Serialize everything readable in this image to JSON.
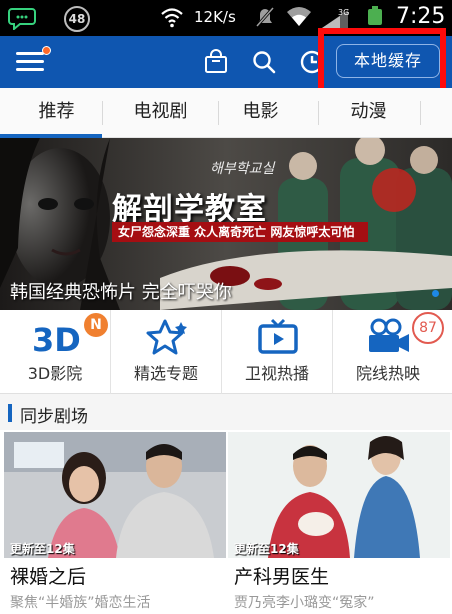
{
  "status_bar": {
    "notification_count": "48",
    "net_speed": "12K/s",
    "network_type": "3G",
    "time": "7:25"
  },
  "app_bar": {
    "menu_icon": "hamburger-menu-icon",
    "shop_icon": "shopping-bag-icon",
    "search_icon": "search-icon",
    "history_icon": "clock-icon",
    "local_cache_label": "本地缓存",
    "accent_color": "#0f56b0",
    "highlight_color": "#ff0b0b"
  },
  "tabs": [
    {
      "label": "推荐",
      "active": true
    },
    {
      "label": "电视剧",
      "active": false
    },
    {
      "label": "电影",
      "active": false
    },
    {
      "label": "动漫",
      "active": false
    }
  ],
  "banner": {
    "title": "解剖学教室",
    "korean_title": "해부학교실",
    "subtitle": "女尸怨念深重 众人离奇死亡 网友惊呼太可怕",
    "caption": "韩国经典恐怖片 完全吓哭你"
  },
  "categories": [
    {
      "label": "3D影院",
      "icon": "3d-icon",
      "badge": "N"
    },
    {
      "label": "精选专题",
      "icon": "star-icon"
    },
    {
      "label": "卫视热播",
      "icon": "tv-icon"
    },
    {
      "label": "院线热映",
      "icon": "movie-camera-icon"
    }
  ],
  "floating_badge": "87",
  "section": {
    "title": "同步剧场"
  },
  "cards": [
    {
      "update": "更新至12集",
      "title": "裸婚之后",
      "description": "聚焦“半婚族”婚恋生活"
    },
    {
      "update": "更新至12集",
      "title": "产科男医生",
      "description": "贾乃亮李小璐变“冤家”"
    }
  ]
}
